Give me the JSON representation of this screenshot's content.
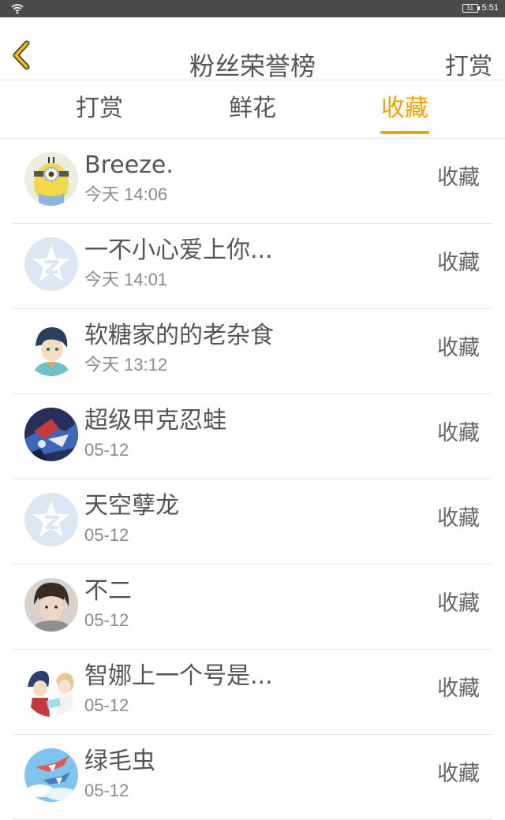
{
  "status_bar": {
    "battery": "31",
    "time": "5:51"
  },
  "header": {
    "back_icon": "chevron-left-icon",
    "title": "粉丝荣誉榜",
    "right_action": "打赏"
  },
  "tabs": [
    {
      "label": "打赏",
      "active": false
    },
    {
      "label": "鲜花",
      "active": false
    },
    {
      "label": "收藏",
      "active": true
    }
  ],
  "colors": {
    "accent": "#f0a400",
    "text": "#555555",
    "subtext": "#8a8a8a",
    "divider": "#e6e6e6"
  },
  "fans": [
    {
      "name": "Breeze.",
      "time": "今天 14:06",
      "action": "收藏",
      "avatar": "minion-avatar"
    },
    {
      "name": "一不小心爱上你...",
      "time": "今天 14:01",
      "action": "收藏",
      "avatar": "default-qzone-avatar"
    },
    {
      "name": "软糖家的的老杂食",
      "time": "今天 13:12",
      "action": "收藏",
      "avatar": "anime-boy-avatar"
    },
    {
      "name": "超级甲克忍蛙",
      "time": "05-12",
      "action": "收藏",
      "avatar": "greninja-avatar"
    },
    {
      "name": "天空孽龙",
      "time": "05-12",
      "action": "收藏",
      "avatar": "default-qzone-avatar"
    },
    {
      "name": "不二",
      "time": "05-12",
      "action": "收藏",
      "avatar": "photo-person-avatar"
    },
    {
      "name": "智娜上一个号是...",
      "time": "05-12",
      "action": "收藏",
      "avatar": "anime-couple-avatar"
    },
    {
      "name": "绿毛虫",
      "time": "05-12",
      "action": "收藏",
      "avatar": "latias-sky-avatar"
    }
  ]
}
